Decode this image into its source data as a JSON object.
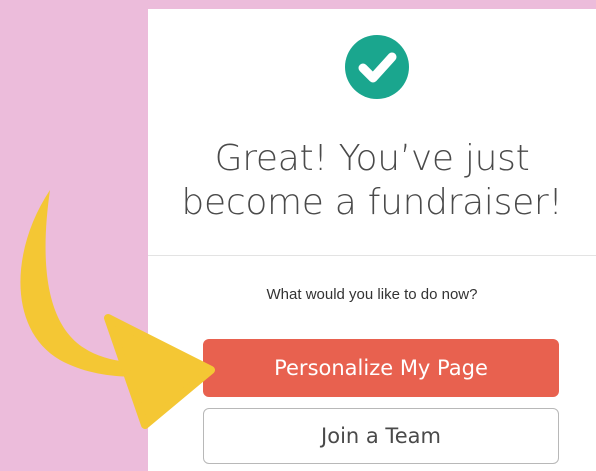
{
  "confirmation": {
    "icon": "checkmark-circle-icon",
    "headline_line1": "Great! You’ve just",
    "headline_line2": "become a fundraiser!",
    "prompt": "What would you like to do now?"
  },
  "actions": {
    "primary_label": "Personalize My Page",
    "secondary_label": "Join a Team"
  },
  "decoration": {
    "arrow_icon": "curved-arrow-icon"
  },
  "colors": {
    "background": "#ecbcdb",
    "success_green": "#1aa68e",
    "primary_button": "#e8614f",
    "arrow_yellow": "#f4c734"
  }
}
